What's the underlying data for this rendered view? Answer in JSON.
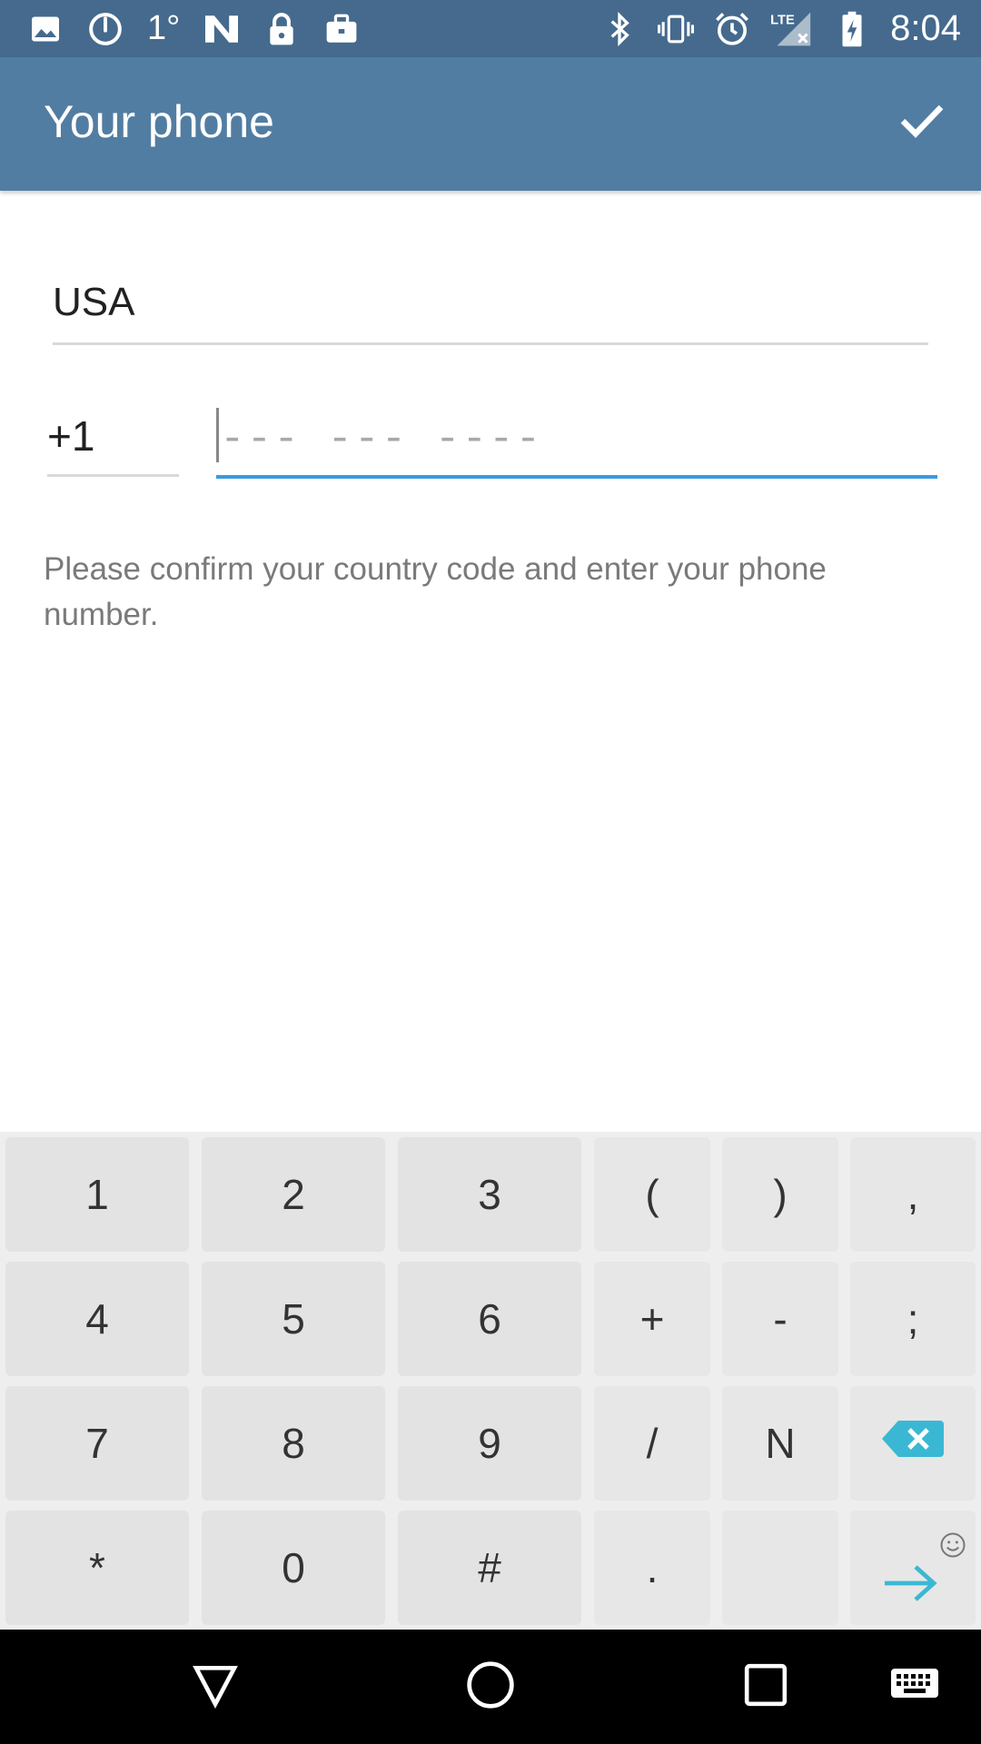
{
  "status_bar": {
    "temperature": "1°",
    "network": "LTE",
    "time": "8:04",
    "left_icons": [
      "image-icon",
      "clock-gauge-icon",
      "n-logo-icon",
      "lock-icon",
      "briefcase-icon"
    ],
    "right_icons": [
      "bluetooth-icon",
      "vibrate-icon",
      "alarm-icon",
      "lte-signal-icon",
      "battery-charging-icon"
    ]
  },
  "app_bar": {
    "title": "Your phone",
    "done_icon": "checkmark-icon"
  },
  "form": {
    "country": "USA",
    "country_code": "+1",
    "phone_placeholder": "--- --- ----",
    "phone_value": "",
    "hint": "Please confirm your country code and enter your phone number."
  },
  "keyboard": {
    "rows": [
      [
        "1",
        "2",
        "3",
        "(",
        ")",
        ","
      ],
      [
        "4",
        "5",
        "6",
        "+",
        "-",
        ";"
      ],
      [
        "7",
        "8",
        "9",
        "/",
        "N",
        "backspace-icon"
      ],
      [
        "*",
        "0",
        "#",
        ".",
        "",
        "enter-arrow-icon"
      ]
    ],
    "accent_color": "#3ab8d3",
    "emoji_hint_icon": "smiley-icon"
  },
  "nav_bar": {
    "icons": [
      "back-triangle-icon",
      "home-circle-icon",
      "recents-square-icon",
      "keyboard-icon"
    ]
  },
  "colors": {
    "status_bar": "#456a8d",
    "app_bar": "#527da3",
    "focus_underline": "#3a9be0"
  }
}
